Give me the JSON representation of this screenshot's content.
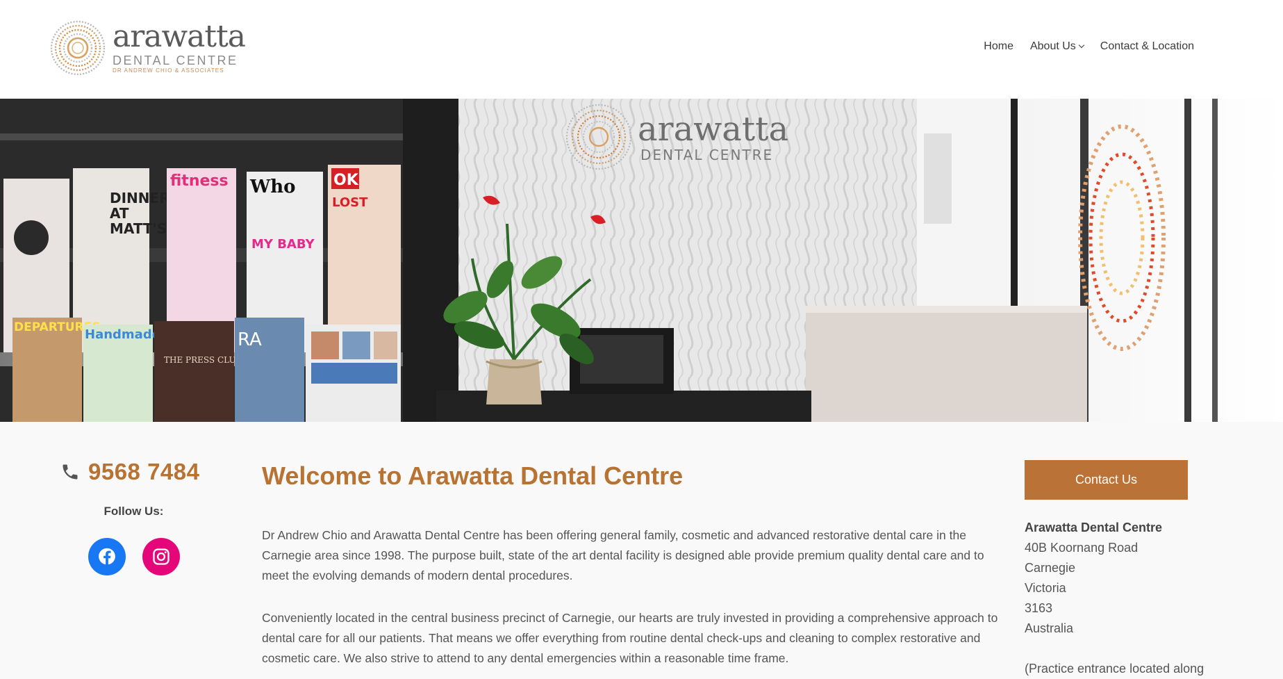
{
  "brand": {
    "name": "arawatta",
    "subtitle": "DENTAL CENTRE",
    "tagline": "DR ANDREW CHIO & ASSOCIATES",
    "accent_color": "#b87333"
  },
  "nav": {
    "items": [
      {
        "label": "Home"
      },
      {
        "label": "About Us",
        "has_dropdown": true
      },
      {
        "label": "Contact & Location"
      }
    ]
  },
  "hero": {
    "sign_name": "arawatta",
    "sign_subtitle": "DENTAL CENTRE",
    "magazines": [
      "DINNER AT MATT'S",
      "fitness",
      "Who",
      "OK",
      "DEPARTURES",
      "Handmade",
      "THE PRESS CLUB",
      "RA",
      "MY BABY SHOWER!"
    ]
  },
  "sidebar": {
    "phone": "9568 7484",
    "follow_label": "Follow Us:",
    "socials": [
      {
        "name": "facebook",
        "icon": "facebook-icon",
        "color": "#1877f2"
      },
      {
        "name": "instagram",
        "icon": "instagram-icon",
        "color": "#e4077a"
      }
    ]
  },
  "main": {
    "title": "Welcome to Arawatta Dental Centre",
    "paragraphs": [
      "Dr Andrew Chio and Arawatta Dental Centre has been offering general family, cosmetic and advanced restorative dental care in the Carnegie area since 1998. The purpose built, state of the art dental facility is designed able provide premium quality dental care and to meet the evolving demands of modern dental procedures.",
      "Conveniently located in the central business precinct of Carnegie, our hearts are truly invested in providing a comprehensive approach to dental care for all our patients. That means we offer everything from routine dental check-ups and cleaning to complex restorative and cosmetic care. We also strive to attend to any dental emergencies within a reasonable time frame."
    ]
  },
  "contact": {
    "button_label": "Contact Us",
    "name": "Arawatta Dental Centre",
    "street": "40B Koornang Road",
    "suburb": "Carnegie",
    "state": "Victoria",
    "postcode": "3163",
    "country": "Australia",
    "note": "(Practice entrance located along"
  }
}
